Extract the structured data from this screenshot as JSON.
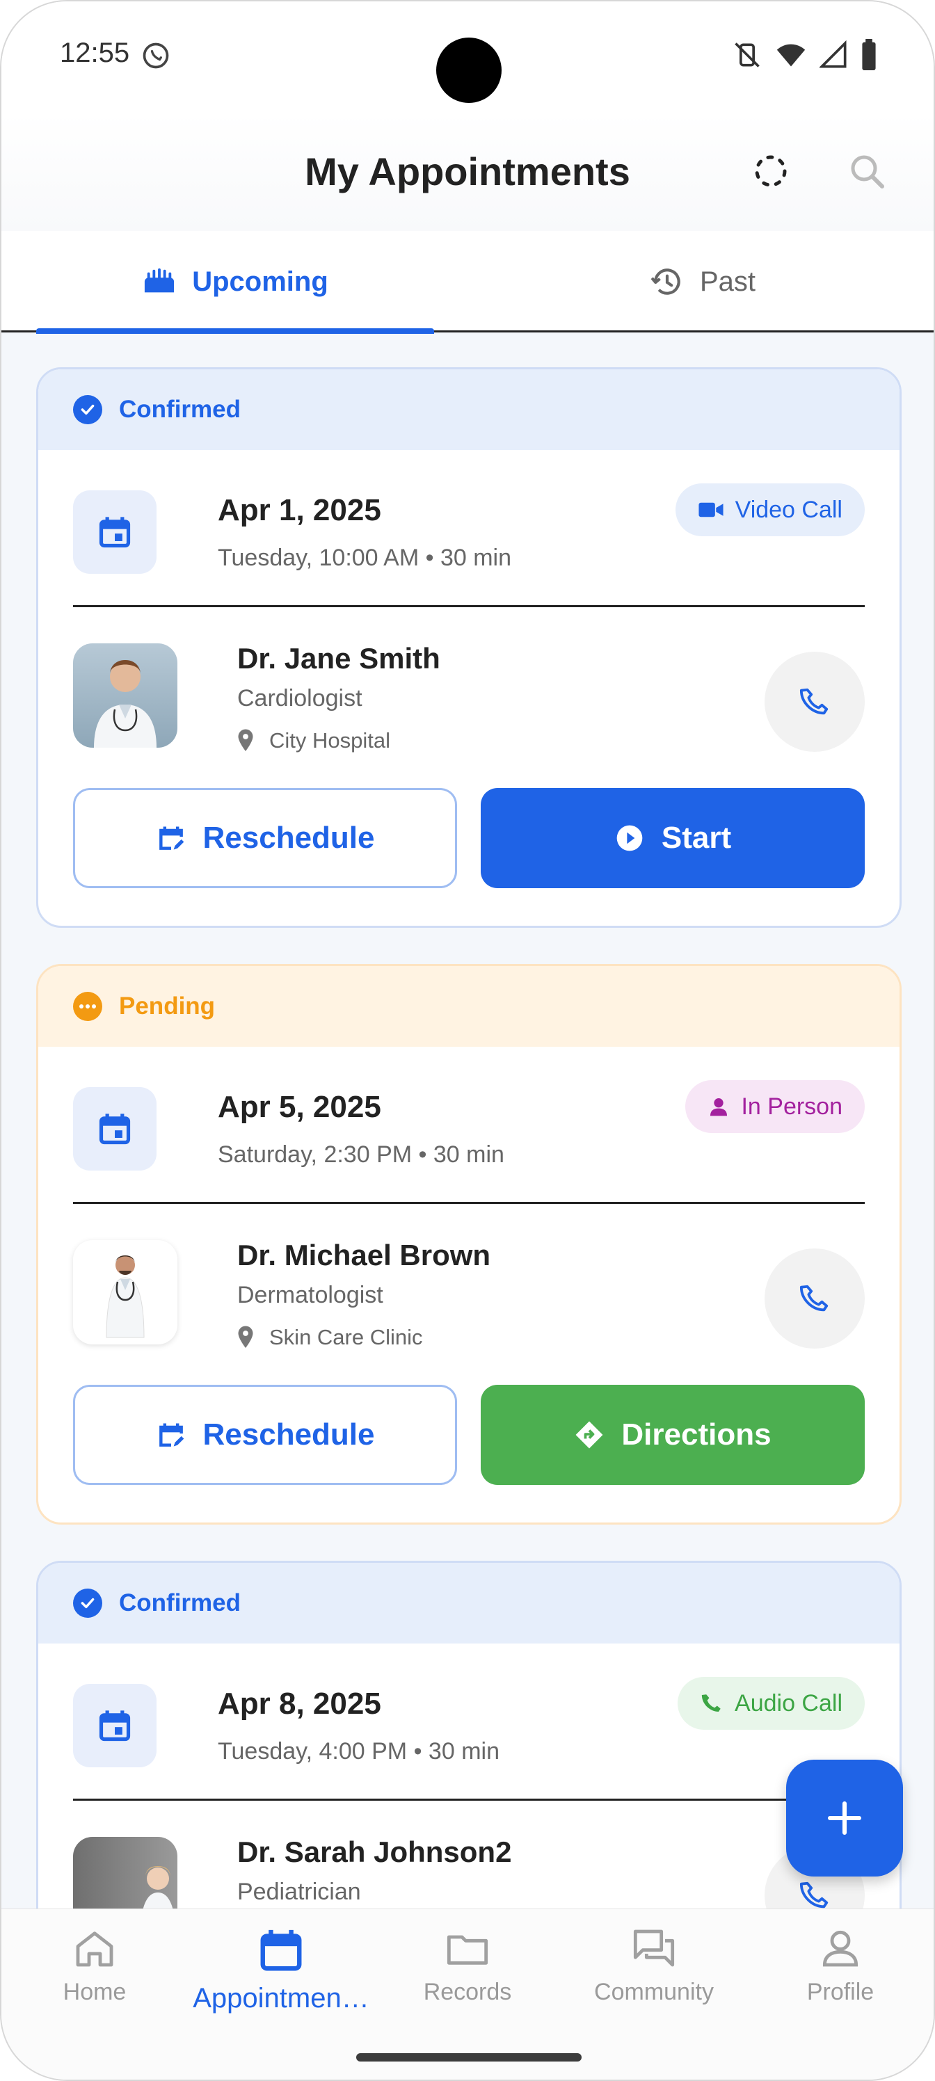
{
  "status_bar": {
    "time": "12:55"
  },
  "app_bar": {
    "title": "My Appointments"
  },
  "tabs": [
    {
      "label": "Upcoming",
      "active": true
    },
    {
      "label": "Past",
      "active": false
    }
  ],
  "appointments": [
    {
      "status": "Confirmed",
      "date": "Apr 1, 2025",
      "time_detail": "Tuesday, 10:00 AM • 30 min",
      "type": "Video Call",
      "doctor": "Dr. Jane Smith",
      "specialty": "Cardiologist",
      "location": "City Hospital",
      "secondary_action": "Reschedule",
      "primary_action": "Start"
    },
    {
      "status": "Pending",
      "date": "Apr 5, 2025",
      "time_detail": "Saturday, 2:30 PM • 30 min",
      "type": "In Person",
      "doctor": "Dr. Michael Brown",
      "specialty": "Dermatologist",
      "location": "Skin Care Clinic",
      "secondary_action": "Reschedule",
      "primary_action": "Directions"
    },
    {
      "status": "Confirmed",
      "date": "Apr 8, 2025",
      "time_detail": "Tuesday, 4:00 PM • 30 min",
      "type": "Audio Call",
      "doctor": "Dr. Sarah Johnson2",
      "specialty": "Pediatrician"
    }
  ],
  "bottom_nav": [
    {
      "label": "Home",
      "icon": "home-icon",
      "active": false
    },
    {
      "label": "Appointmen…",
      "icon": "calendar-icon",
      "active": true
    },
    {
      "label": "Records",
      "icon": "folder-icon",
      "active": false
    },
    {
      "label": "Community",
      "icon": "chat-icon",
      "active": false
    },
    {
      "label": "Profile",
      "icon": "person-icon",
      "active": false
    }
  ],
  "colors": {
    "primary": "#1f63e6",
    "pending": "#f39a12",
    "success": "#4caf50",
    "in_person": "#a3219e"
  }
}
